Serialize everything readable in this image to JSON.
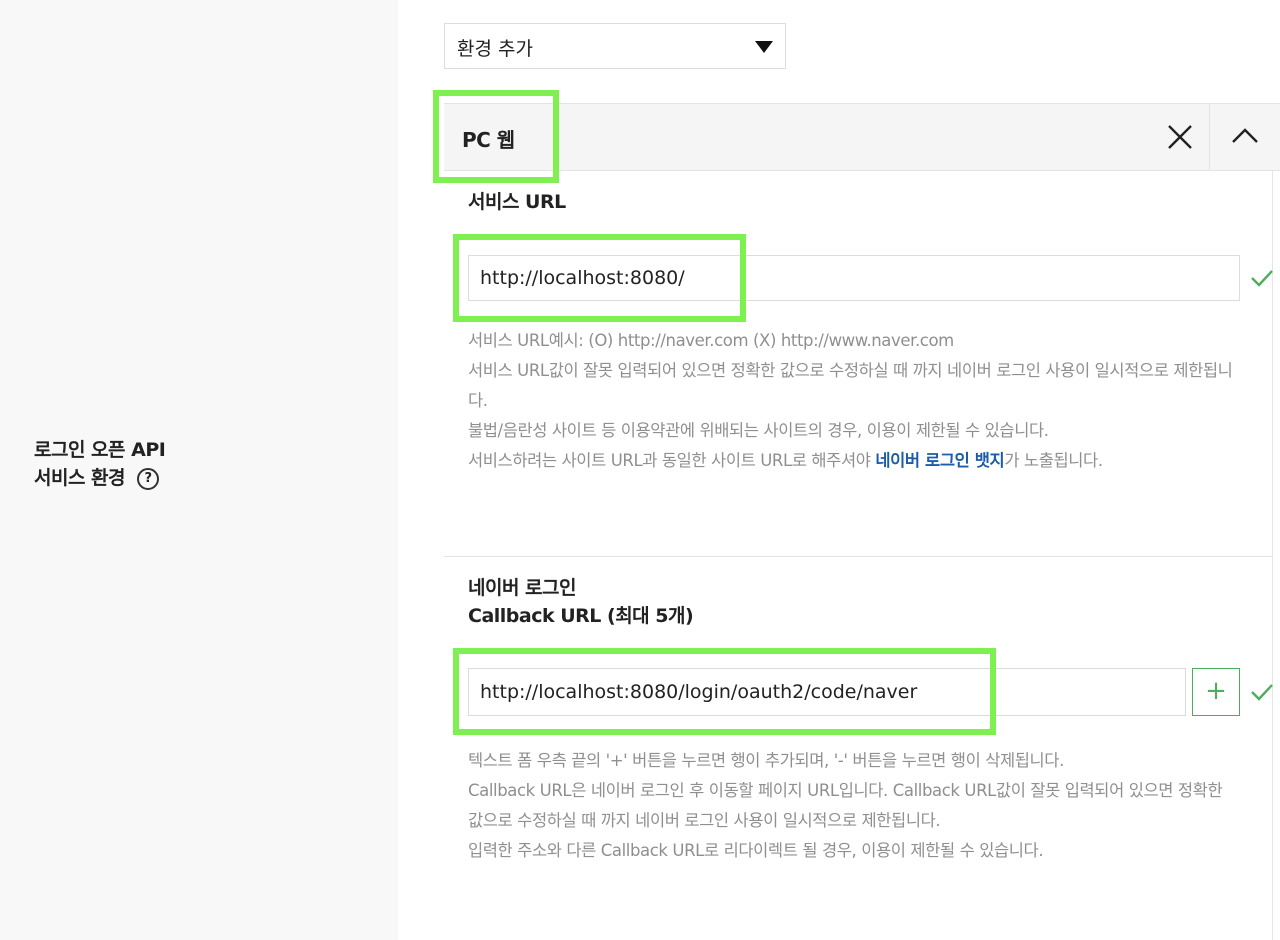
{
  "section": {
    "label_line1": "로그인 오픈 API",
    "label_line2": "서비스 환경",
    "help_icon_glyph": "?"
  },
  "env_select": {
    "value": "환경 추가"
  },
  "panel": {
    "title": "PC 웹"
  },
  "service_url": {
    "label": "서비스 URL",
    "value": "http://localhost:8080/",
    "help": [
      "서비스 URL예시: (O) http://naver.com (X) http://www.naver.com",
      "서비스 URL값이 잘못 입력되어 있으면 정확한 값으로 수정하실 때 까지 네이버 로그인 사용이 일시적으로 제한됩니다.",
      "불법/음란성 사이트 등 이용약관에 위배되는 사이트의 경우, 이용이 제한될 수 있습니다."
    ],
    "badge_pre": "서비스하려는 사이트 URL과 동일한 사이트 URL로 해주셔야 ",
    "badge_link": "네이버 로그인 뱃지",
    "badge_post": "가 노출됩니다."
  },
  "callback": {
    "label_line1": "네이버 로그인",
    "label_line2": "Callback URL (최대 5개)",
    "value": "http://localhost:8080/login/oauth2/code/naver",
    "add_label": "+",
    "help": [
      "텍스트 폼 우측 끝의 '+' 버튼을 누르면 행이 추가되며, '-' 버튼을 누르면 행이 삭제됩니다.",
      "Callback URL은 네이버 로그인 후 이동할 페이지 URL입니다. Callback URL값이 잘못 입력되어 있으면 정확한 값으로 수정하실 때 까지 네이버 로그인 사용이 일시적으로 제한됩니다.",
      "입력한 주소와 다른 Callback URL로 리다이렉트 될 경우, 이용이 제한될 수 있습니다."
    ]
  },
  "icons": {
    "dropdown": "caret-down-icon",
    "close": "close-icon",
    "collapse": "chevron-up-icon",
    "valid": "check-icon",
    "help": "help-circle-icon"
  },
  "colors": {
    "highlight": "#7ef04f",
    "accent_green": "#4fae5c",
    "link_blue": "#1c5ca8",
    "help_text": "#8f8f8f"
  }
}
